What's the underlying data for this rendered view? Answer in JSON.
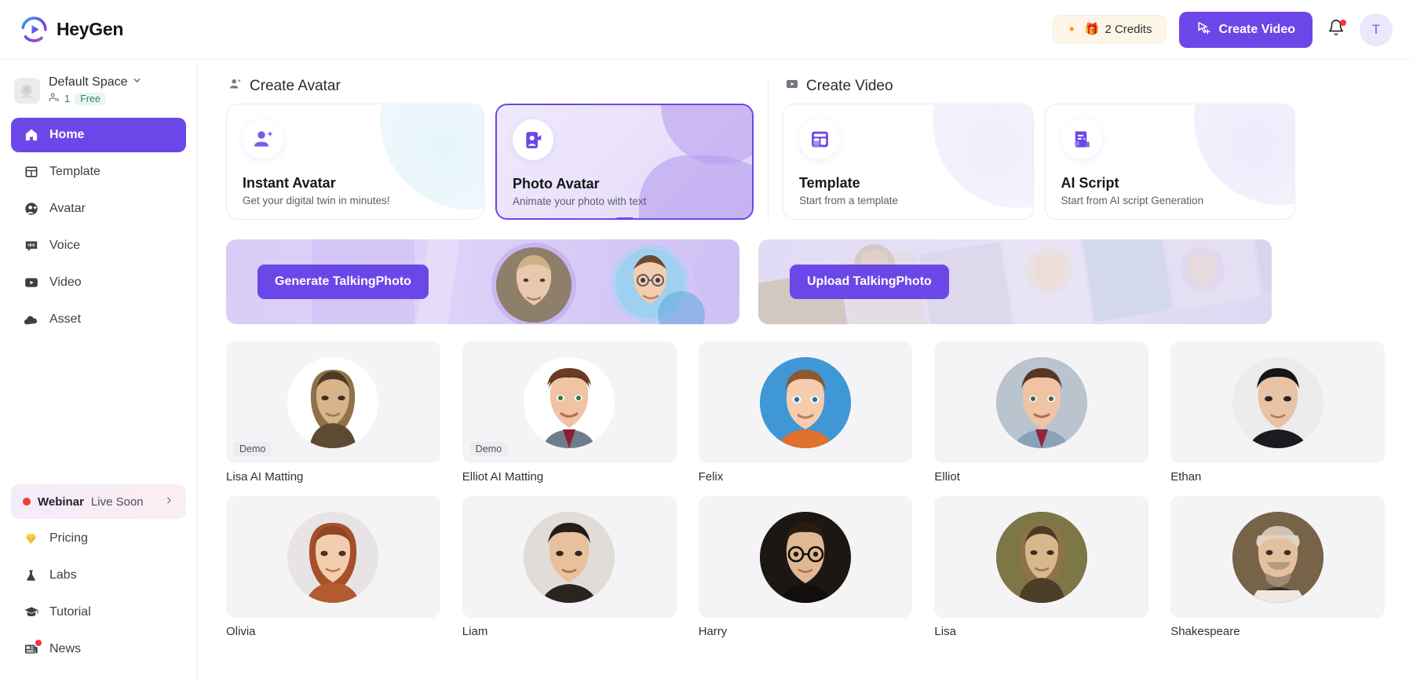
{
  "header": {
    "brand_name": "HeyGen",
    "brand_logo_icon": "heygen-logo-icon",
    "credits_label": "2 Credits",
    "credits_icon_left": "diamond-icon",
    "credits_icon_right": "gift-icon",
    "create_video_label": "Create Video",
    "create_video_icon": "video-add-cursor-icon",
    "notification_icon": "bell-icon",
    "notification_has_unread": true,
    "user_initial": "T"
  },
  "sidebar": {
    "space": {
      "name": "Default Space",
      "chevron_icon": "chevron-down-icon",
      "members_icon": "users-icon",
      "members_count": "1",
      "plan_badge": "Free",
      "thumb_icon": "space-thumbnail-icon"
    },
    "items": [
      {
        "label": "Home",
        "icon": "home-icon",
        "active": true
      },
      {
        "label": "Template",
        "icon": "template-icon",
        "active": false
      },
      {
        "label": "Avatar",
        "icon": "avatar-icon",
        "active": false
      },
      {
        "label": "Voice",
        "icon": "voice-icon",
        "active": false
      },
      {
        "label": "Video",
        "icon": "video-icon",
        "active": false
      },
      {
        "label": "Asset",
        "icon": "asset-cloud-icon",
        "active": false
      }
    ],
    "webinar": {
      "title": "Webinar",
      "subtitle": "Live Soon",
      "dot_icon": "live-dot-icon",
      "chevron_icon": "chevron-right-icon"
    },
    "bottom_items": [
      {
        "label": "Pricing",
        "icon": "diamond-icon",
        "badge": false
      },
      {
        "label": "Labs",
        "icon": "flask-icon",
        "badge": false
      },
      {
        "label": "Tutorial",
        "icon": "graduation-cap-icon",
        "badge": false
      },
      {
        "label": "News",
        "icon": "news-icon",
        "badge": true
      }
    ]
  },
  "main": {
    "create_avatar": {
      "heading": "Create Avatar",
      "heading_icon": "user-plus-icon",
      "cards": [
        {
          "title": "Instant Avatar",
          "subtitle": "Get your digital twin in minutes!",
          "icon": "instant-avatar-icon",
          "selected": false
        },
        {
          "title": "Photo Avatar",
          "subtitle": "Animate your photo with text",
          "icon": "photo-avatar-icon",
          "selected": true
        }
      ]
    },
    "create_video": {
      "heading": "Create Video",
      "heading_icon": "video-play-icon",
      "cards": [
        {
          "title": "Template",
          "subtitle": "Start from a template",
          "icon": "template-layout-icon",
          "selected": false
        },
        {
          "title": "AI Script",
          "subtitle": "Start from AI script Generation",
          "icon": "ai-script-icon",
          "selected": false
        }
      ]
    },
    "banners": [
      {
        "button_label": "Generate TalkingPhoto",
        "name": "generate-talkingphoto"
      },
      {
        "button_label": "Upload TalkingPhoto",
        "name": "upload-talkingphoto"
      }
    ],
    "avatars": [
      {
        "name": "Lisa AI Matting",
        "badge": "Demo"
      },
      {
        "name": "Elliot AI Matting",
        "badge": "Demo"
      },
      {
        "name": "Felix",
        "badge": ""
      },
      {
        "name": "Elliot",
        "badge": ""
      },
      {
        "name": "Ethan",
        "badge": ""
      },
      {
        "name": "Olivia",
        "badge": ""
      },
      {
        "name": "Liam",
        "badge": ""
      },
      {
        "name": "Harry",
        "badge": ""
      },
      {
        "name": "Lisa",
        "badge": ""
      },
      {
        "name": "Shakespeare",
        "badge": ""
      }
    ]
  },
  "colors": {
    "accent": "#6c47e8",
    "accent_light": "#e9e1fb",
    "danger": "#f5333f",
    "text": "#2e3034",
    "muted": "#62656c"
  }
}
